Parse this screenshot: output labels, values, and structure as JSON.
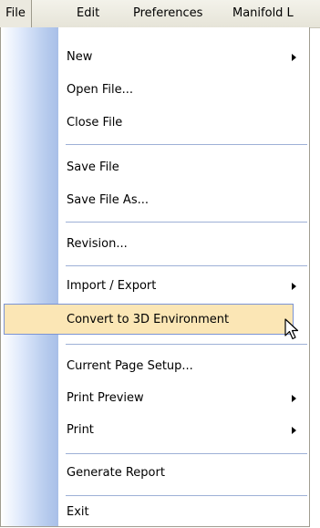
{
  "menubar": {
    "file": "File",
    "edit": "Edit",
    "preferences": "Preferences",
    "manifold": "Manifold L"
  },
  "file_menu": {
    "new": "New",
    "open_file": "Open File...",
    "close_file": "Close File",
    "save_file": "Save File",
    "save_file_as": "Save File As...",
    "revision": "Revision...",
    "import_export": "Import / Export",
    "convert_3d": "Convert to 3D Environment",
    "page_setup": "Current Page Setup...",
    "print_preview": "Print Preview",
    "print": "Print",
    "generate_report": "Generate Report",
    "exit": "Exit"
  },
  "colors": {
    "highlight_fill": "#fbe6b5",
    "highlight_border": "#7b94d4",
    "gutter": "#b9cdee"
  }
}
